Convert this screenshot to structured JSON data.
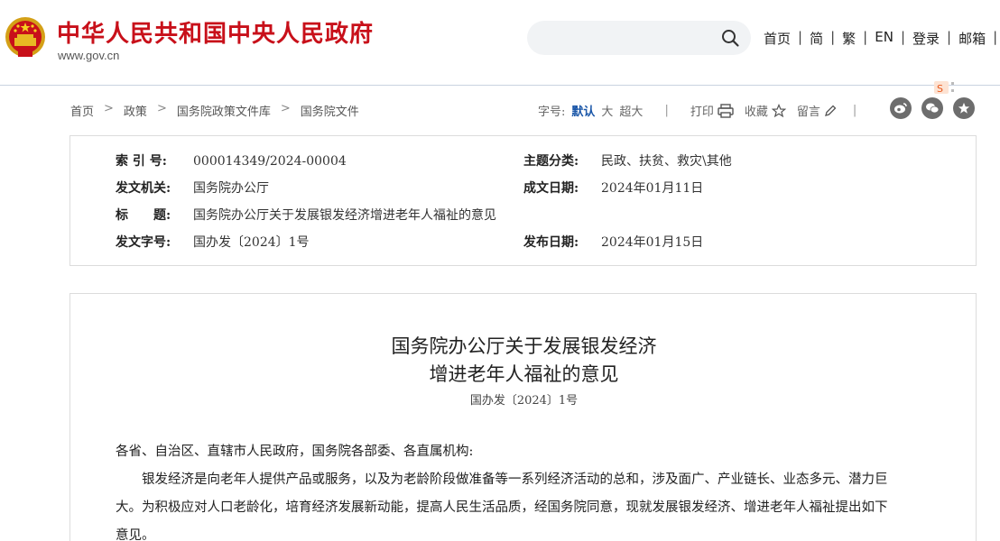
{
  "header": {
    "site_title": "中华人民共和国中央人民政府",
    "site_url": "www.gov.cn",
    "search_placeholder": "",
    "nav": [
      "首页",
      "简",
      "繁",
      "EN",
      "登录",
      "邮箱"
    ],
    "nav_separator": "|"
  },
  "breadcrumb": {
    "items": [
      "首页",
      "政策",
      "国务院政策文件库",
      "国务院文件"
    ],
    "separator": ">"
  },
  "tools": {
    "font_size_label": "字号:",
    "font_default": "默认",
    "font_large": "大",
    "font_xlarge": "超大",
    "print": "打印",
    "favorite": "收藏",
    "comment": "留言",
    "divider": "|"
  },
  "share_icons": [
    "weibo-icon",
    "wechat-icon",
    "favorite-star-icon"
  ],
  "info": {
    "index_label": "索 引 号:",
    "index_value": "000014349/2024-00004",
    "category_label": "主题分类:",
    "category_value": "民政、扶贫、救灾\\其他",
    "issuer_label": "发文机关:",
    "issuer_value": "国务院办公厅",
    "written_date_label": "成文日期:",
    "written_date_value": "2024年01月11日",
    "title_label": "标　　题:",
    "title_value": "国务院办公厅关于发展银发经济增进老年人福祉的意见",
    "doc_no_label": "发文字号:",
    "doc_no_value": "国办发〔2024〕1号",
    "publish_date_label": "发布日期:",
    "publish_date_value": "2024年01月15日"
  },
  "article": {
    "title_line1": "国务院办公厅关于发展银发经济",
    "title_line2": "增进老年人福祉的意见",
    "doc_no": "国办发〔2024〕1号",
    "salutation": "各省、自治区、直辖市人民政府，国务院各部委、各直属机构:",
    "para1_line1": "　　银发经济是向老年人提供产品或服务，以及为老龄阶段做准备等一系列经济活动的总和，涉及面广、产业链长、业态多元、潜力巨",
    "para1_line2": "大。为积极应对人口老龄化，培育经济发展新动能，提高人民生活品质，经国务院同意，现就发展银发经济、增进老年人福祉提出如下",
    "para1_line3": "意见。"
  },
  "colors": {
    "brand_red": "#c8101a",
    "link_blue": "#1a56a8",
    "border": "#dcdcdc"
  }
}
